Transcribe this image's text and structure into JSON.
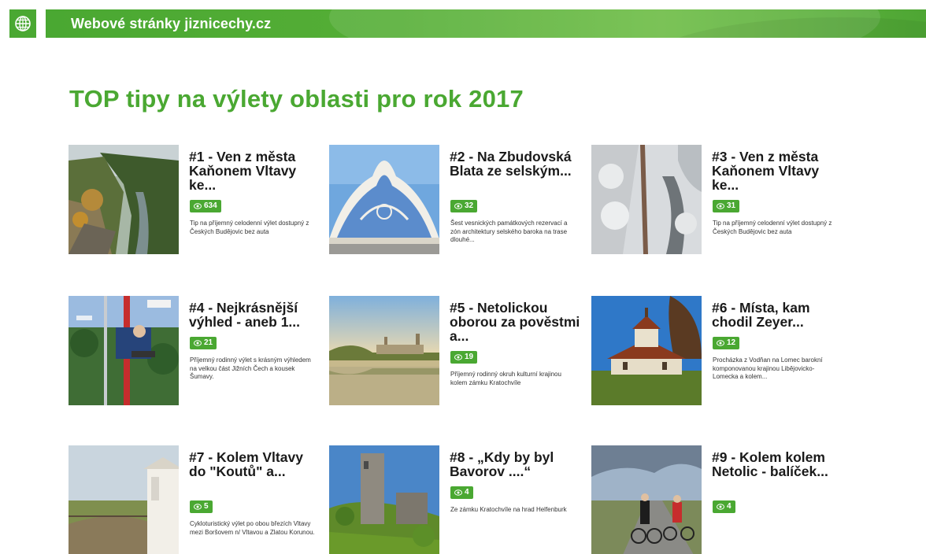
{
  "header": {
    "site_title": "Webové stránky jiznicechy.cz",
    "globe_icon": "globe-icon",
    "accent_color": "#4aa832"
  },
  "page_title": "TOP tipy na výlety oblasti pro rok 2017",
  "trips": [
    {
      "title": "#1 - Ven z města Kaňonem Vltavy ke...",
      "views": "634",
      "desc": "Tip na příjemný celodenní výlet dostupný z Českých Budějovic bez auta"
    },
    {
      "title": "#2 - Na Zbudovská Blata ze selským...",
      "views": "32",
      "desc": "Šest vesnických památkových rezervací a zón architektury selského baroka na trase dlouhé..."
    },
    {
      "title": "#3 - Ven z města Kaňonem Vltavy ke...",
      "views": "31",
      "desc": "Tip na příjemný celodenní výlet dostupný z Českých Budějovic bez auta"
    },
    {
      "title": "#4 - Nejkrásnější výhled - aneb 1...",
      "views": "21",
      "desc": "Příjemný rodinný výlet s krásným výhledem na velkou část Jižních Čech a kousek Šumavy."
    },
    {
      "title": "#5 - Netolickou oborou za pověstmi a...",
      "views": "19",
      "desc": "Příjemný rodinný okruh kulturní krajinou kolem zámku Kratochvíle"
    },
    {
      "title": "#6 - Místa, kam chodil Zeyer...",
      "views": "12",
      "desc": "Procházka z Vodňan na Lomec barokní komponovanou krajinou Libějovicko-Lomecka a kolem..."
    },
    {
      "title": "#7 - Kolem Vltavy do \"Koutů\" a...",
      "views": "5",
      "desc": "Cykloturistický výlet po obou březích Vltavy mezi Boršovem n/ Vltavou a Zlatou Korunou."
    },
    {
      "title": "#8 - „Kdy by byl Bavorov ....“",
      "views": "4",
      "desc": "Ze zámku Kratochvíle na hrad Helfenburk"
    },
    {
      "title": "#9 - Kolem kolem Netolic - balíček...",
      "views": "4",
      "desc": ""
    }
  ]
}
